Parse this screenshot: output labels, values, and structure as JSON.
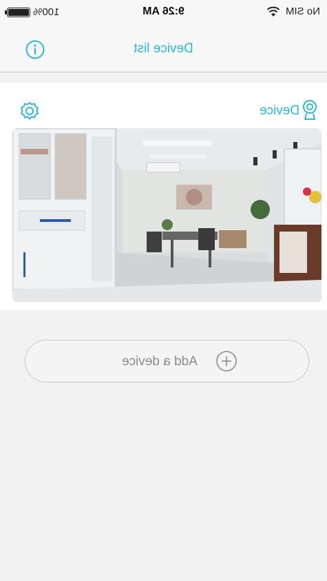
{
  "status_bar": {
    "battery": "100%",
    "time": "9:26 AM",
    "carrier": "No SIM"
  },
  "nav": {
    "title": "Device list"
  },
  "device_card": {
    "name": "Device"
  },
  "add_device": {
    "label": "Add a device"
  },
  "colors": {
    "accent": "#2bb8d9",
    "background": "#f2f2f2"
  },
  "icons": [
    "battery-icon",
    "wifi-icon",
    "info-icon",
    "settings-gear-icon",
    "camera-pin-icon",
    "plus-circle-icon"
  ]
}
